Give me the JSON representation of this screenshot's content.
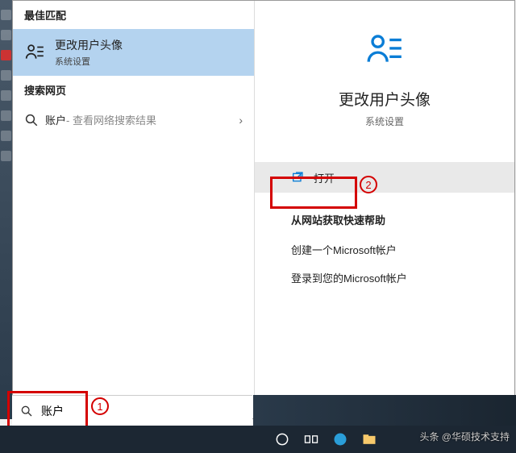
{
  "left": {
    "best_header": "最佳匹配",
    "match_title": "更改用户头像",
    "match_sub": "系统设置",
    "web_header": "搜索网页",
    "web_term": "账户",
    "web_desc": " - 查看网络搜索结果"
  },
  "right": {
    "title": "更改用户头像",
    "sub": "系统设置",
    "open": "打开",
    "quick_header": "从网站获取快速帮助",
    "quick1": "创建一个Microsoft帐户",
    "quick2": "登录到您的Microsoft帐户"
  },
  "search": {
    "value": "账户"
  },
  "annot": {
    "n1": "1",
    "n2": "2"
  },
  "watermark": "头条 @华硕技术支持"
}
